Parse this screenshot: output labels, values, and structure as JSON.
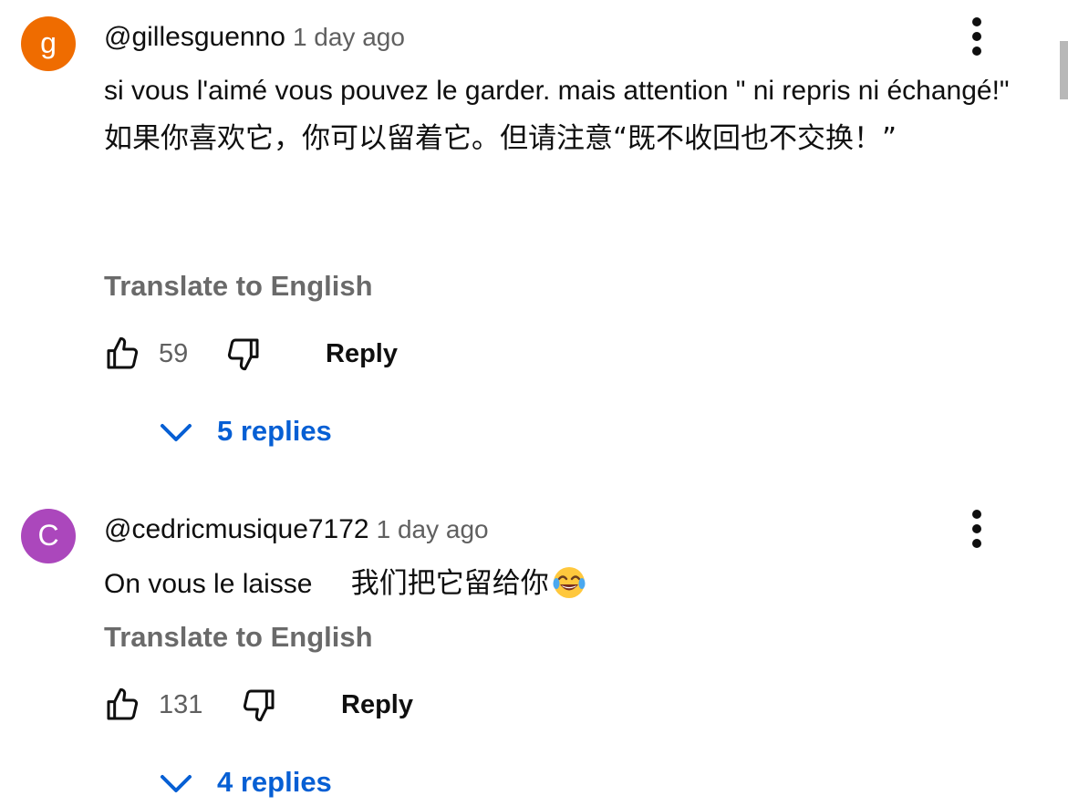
{
  "colors": {
    "avatar_1": "#ef6c00",
    "avatar_2": "#ab47bc",
    "link_blue": "#065fd4",
    "muted_text": "#606060"
  },
  "comments": [
    {
      "avatar_letter": "g",
      "author": "@gillesguenno",
      "time": "1 day ago",
      "text_fr": "si vous l'aimé vous pouvez le garder. mais attention \" ni repris ni échangé!\"",
      "text_zh": "如果你喜欢它，你可以留着它。但请注意“既不收回也不交换！”",
      "translate_label": "Translate to English",
      "like_count": "59",
      "reply_label": "Reply",
      "replies_label": "5 replies",
      "icons": [
        "thumb-up-icon",
        "thumb-down-icon",
        "chevron-down-icon",
        "more-vert-icon"
      ]
    },
    {
      "avatar_letter": "C",
      "author": "@cedricmusique7172",
      "time": "1 day ago",
      "text_fr": "On vous le laisse",
      "text_zh": "我们把它留给你",
      "emoji": "face-with-tears-of-joy",
      "translate_label": "Translate to English",
      "like_count": "131",
      "reply_label": "Reply",
      "replies_label": "4 replies",
      "icons": [
        "thumb-up-icon",
        "thumb-down-icon",
        "chevron-down-icon",
        "more-vert-icon"
      ]
    }
  ]
}
